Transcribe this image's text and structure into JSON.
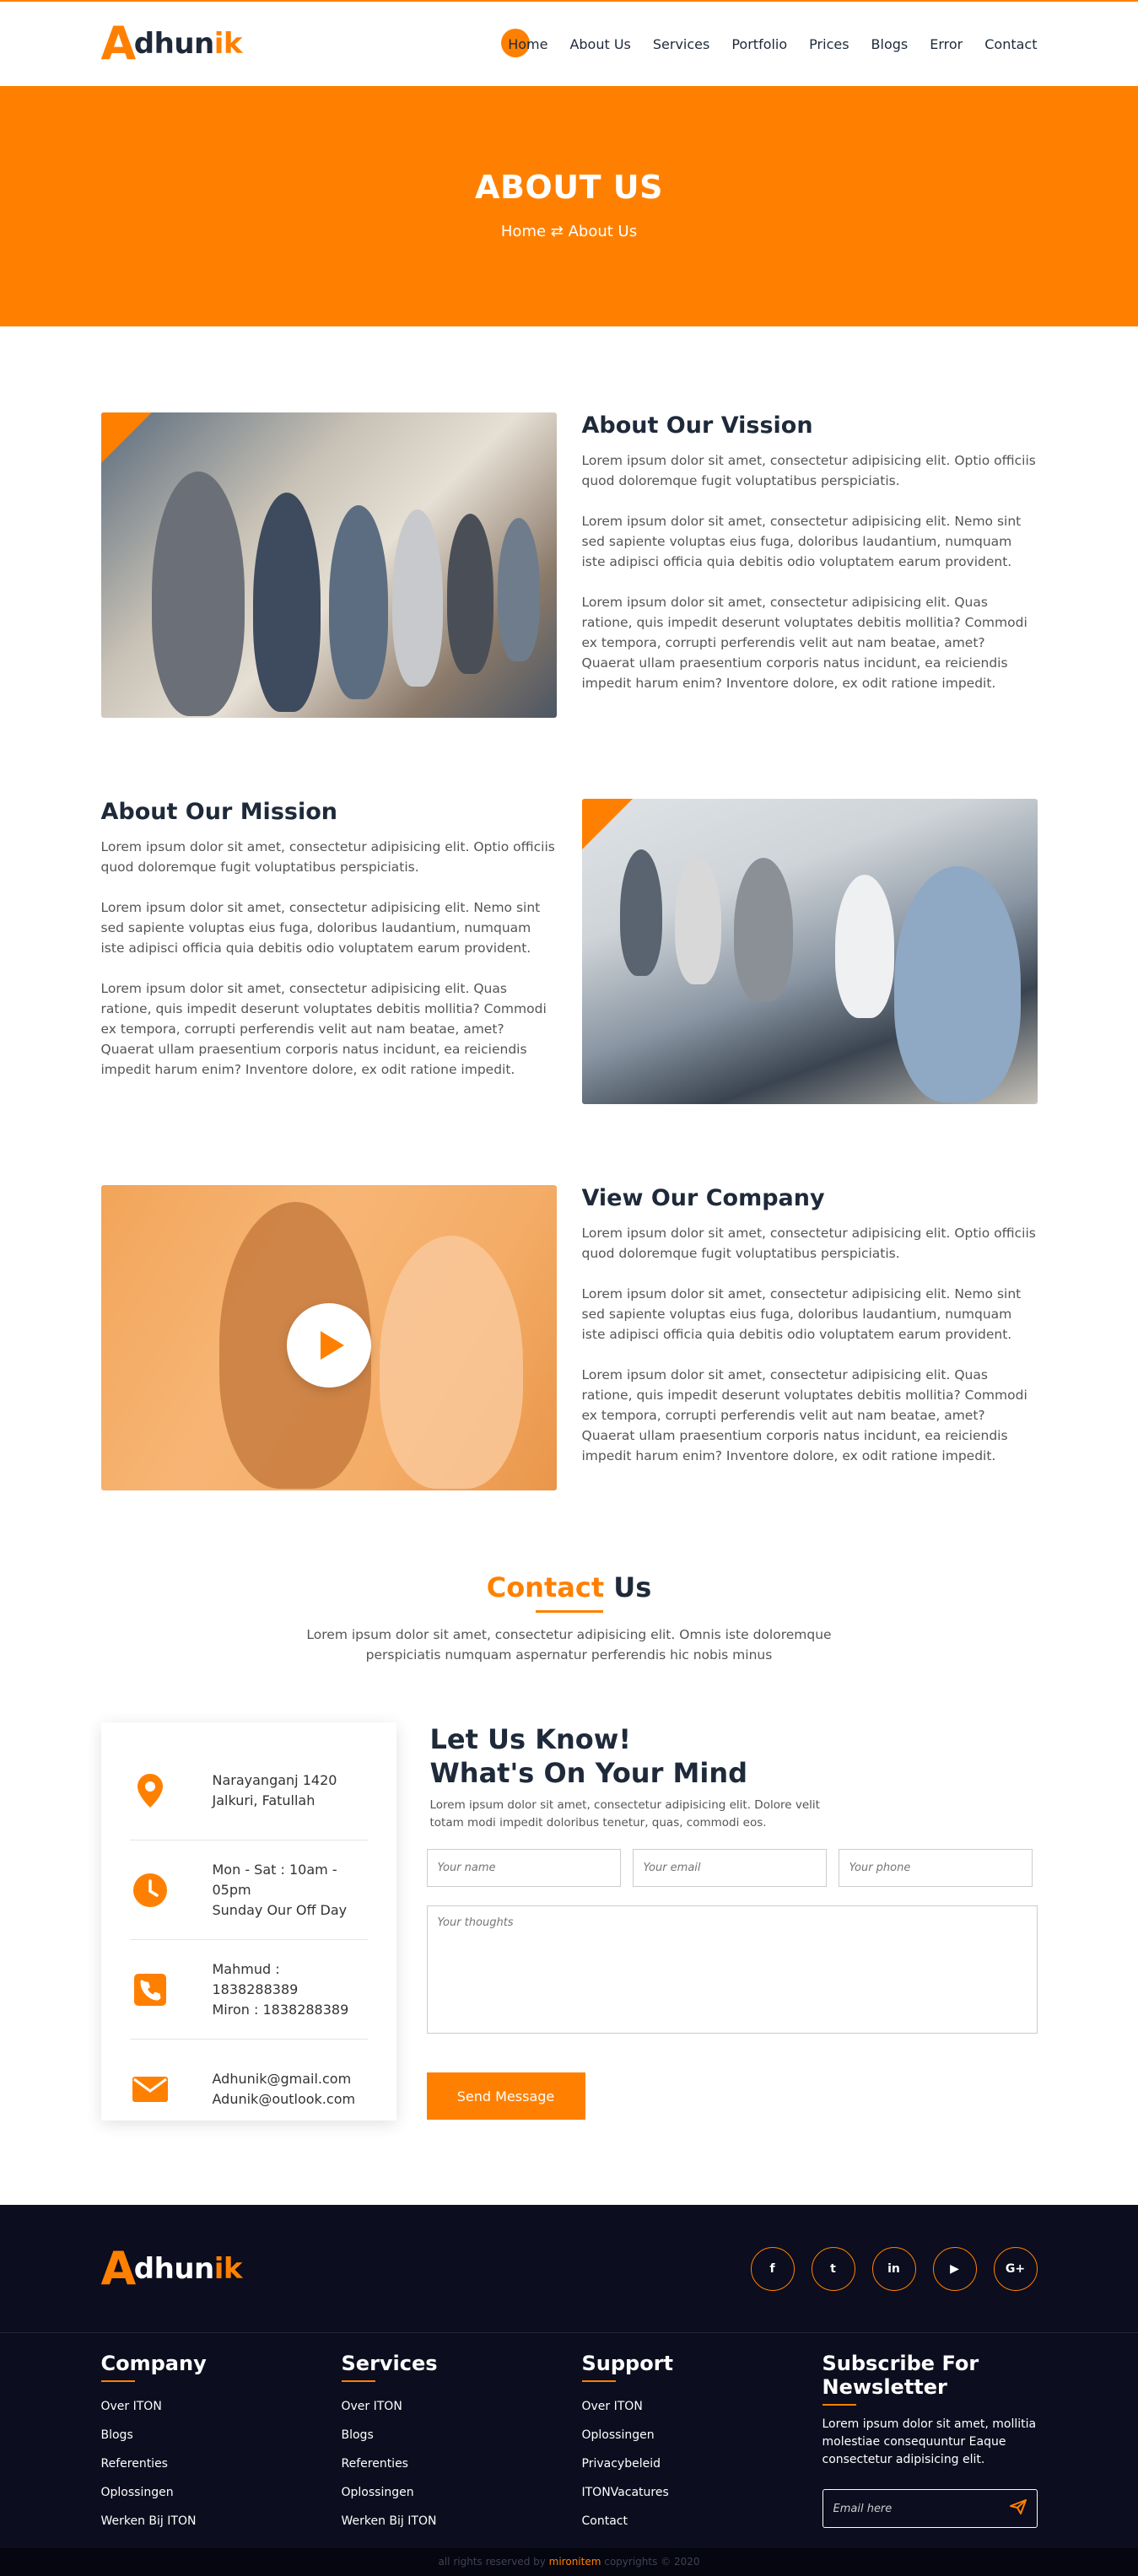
{
  "brand": {
    "big_letter": "A",
    "rest": "dhun",
    "accent": "ik"
  },
  "nav": [
    "Home",
    "About Us",
    "Services",
    "Portfolio",
    "Prices",
    "Blogs",
    "Error",
    "Contact"
  ],
  "hero": {
    "title": "ABOUT US",
    "crumb_home": "Home",
    "crumb_sep": "⇄",
    "crumb_current": "About Us"
  },
  "sections": [
    {
      "title": "About Our Vission",
      "p1": "Lorem ipsum dolor sit amet, consectetur adipisicing elit. Optio officiis quod doloremque fugit voluptatibus perspiciatis.",
      "p2": "Lorem ipsum dolor sit amet, consectetur adipisicing elit. Nemo sint sed sapiente voluptas eius fuga, doloribus laudantium, numquam iste adipisci officia quia debitis odio voluptatem earum provident.",
      "p3": "Lorem ipsum dolor sit amet, consectetur adipisicing elit. Quas ratione, quis impedit deserunt voluptates debitis mollitia? Commodi ex tempora, corrupti perferendis velit aut nam beatae, amet? Quaerat ullam praesentium corporis natus incidunt, ea reiciendis impedit harum enim? Inventore dolore, ex odit ratione impedit."
    },
    {
      "title": "About Our Mission",
      "p1": "Lorem ipsum dolor sit amet, consectetur adipisicing elit. Optio officiis quod doloremque fugit voluptatibus perspiciatis.",
      "p2": "Lorem ipsum dolor sit amet, consectetur adipisicing elit. Nemo sint sed sapiente voluptas eius fuga, doloribus laudantium, numquam iste adipisci officia quia debitis odio voluptatem earum provident.",
      "p3": "Lorem ipsum dolor sit amet, consectetur adipisicing elit. Quas ratione, quis impedit deserunt voluptates debitis mollitia? Commodi ex tempora, corrupti perferendis velit aut nam beatae, amet? Quaerat ullam praesentium corporis natus incidunt, ea reiciendis impedit harum enim? Inventore dolore, ex odit ratione impedit."
    },
    {
      "title": "View Our Company",
      "p1": "Lorem ipsum dolor sit amet, consectetur adipisicing elit. Optio officiis quod doloremque fugit voluptatibus perspiciatis.",
      "p2": "Lorem ipsum dolor sit amet, consectetur adipisicing elit. Nemo sint sed sapiente voluptas eius fuga, doloribus laudantium, numquam iste adipisci officia quia debitis odio voluptatem earum provident.",
      "p3": "Lorem ipsum dolor sit amet, consectetur adipisicing elit. Quas ratione, quis impedit deserunt voluptates debitis mollitia? Commodi ex tempora, corrupti perferendis velit aut nam beatae, amet? Quaerat ullam praesentium corporis natus incidunt, ea reiciendis impedit harum enim? Inventore dolore, ex odit ratione impedit."
    }
  ],
  "contact": {
    "title_accent": "Contact",
    "title_rest": " Us",
    "intro": "Lorem ipsum dolor sit amet, consectetur adipisicing elit. Omnis iste doloremque perspiciatis numquam aspernatur perferendis hic nobis minus",
    "info": [
      {
        "icon": "location-pin-icon",
        "line1": "Narayanganj 1420",
        "line2": "Jalkuri, Fatullah"
      },
      {
        "icon": "clock-icon",
        "line1": "Mon - Sat : 10am - 05pm",
        "line2": "Sunday Our Off Day"
      },
      {
        "icon": "phone-icon",
        "line1": "Mahmud : 1838288389",
        "line2": "Miron : 1838288389"
      },
      {
        "icon": "envelope-icon",
        "line1": "Adhunik@gmail.com",
        "line2": "Adunik@outlook.com"
      }
    ],
    "form_title_1": "Let Us Know!",
    "form_title_2": "What's On Your Mind",
    "form_sub": "Lorem ipsum dolor sit amet, consectetur adipisicing elit. Dolore velit totam modi impedit doloribus tenetur, quas, commodi eos.",
    "ph_name": "Your name",
    "ph_email": "Your email",
    "ph_phone": "Your phone",
    "ph_thoughts": "Your thoughts",
    "send_label": "Send Message"
  },
  "footer": {
    "socials": [
      "f",
      "t",
      "in",
      "▶",
      "G+"
    ],
    "cols": [
      {
        "title": "Company",
        "links": [
          "Over ITON",
          "Blogs",
          "Referenties",
          "Oplossingen",
          "Werken Bij ITON"
        ]
      },
      {
        "title": "Services",
        "links": [
          "Over ITON",
          "Blogs",
          "Referenties",
          "Oplossingen",
          "Werken Bij ITON"
        ]
      },
      {
        "title": "Support",
        "links": [
          "Over ITON",
          "Oplossingen",
          "Privacybeleid",
          "ITONVacatures",
          "Contact"
        ]
      }
    ],
    "newsletter_title": "Subscribe For Newsletter",
    "newsletter_text": "Lorem ipsum dolor sit amet, mollitia molestiae consequuntur Eaque consectetur adipisicing elit.",
    "email_placeholder": "Email here",
    "copy_pre": "all rights reserved by ",
    "copy_brand": "mironitem",
    "copy_post": " copyrights © 2020"
  },
  "colors": {
    "accent": "#ff8000",
    "dark": "#1e2a3a",
    "footer_bg": "#0c0d1e"
  }
}
